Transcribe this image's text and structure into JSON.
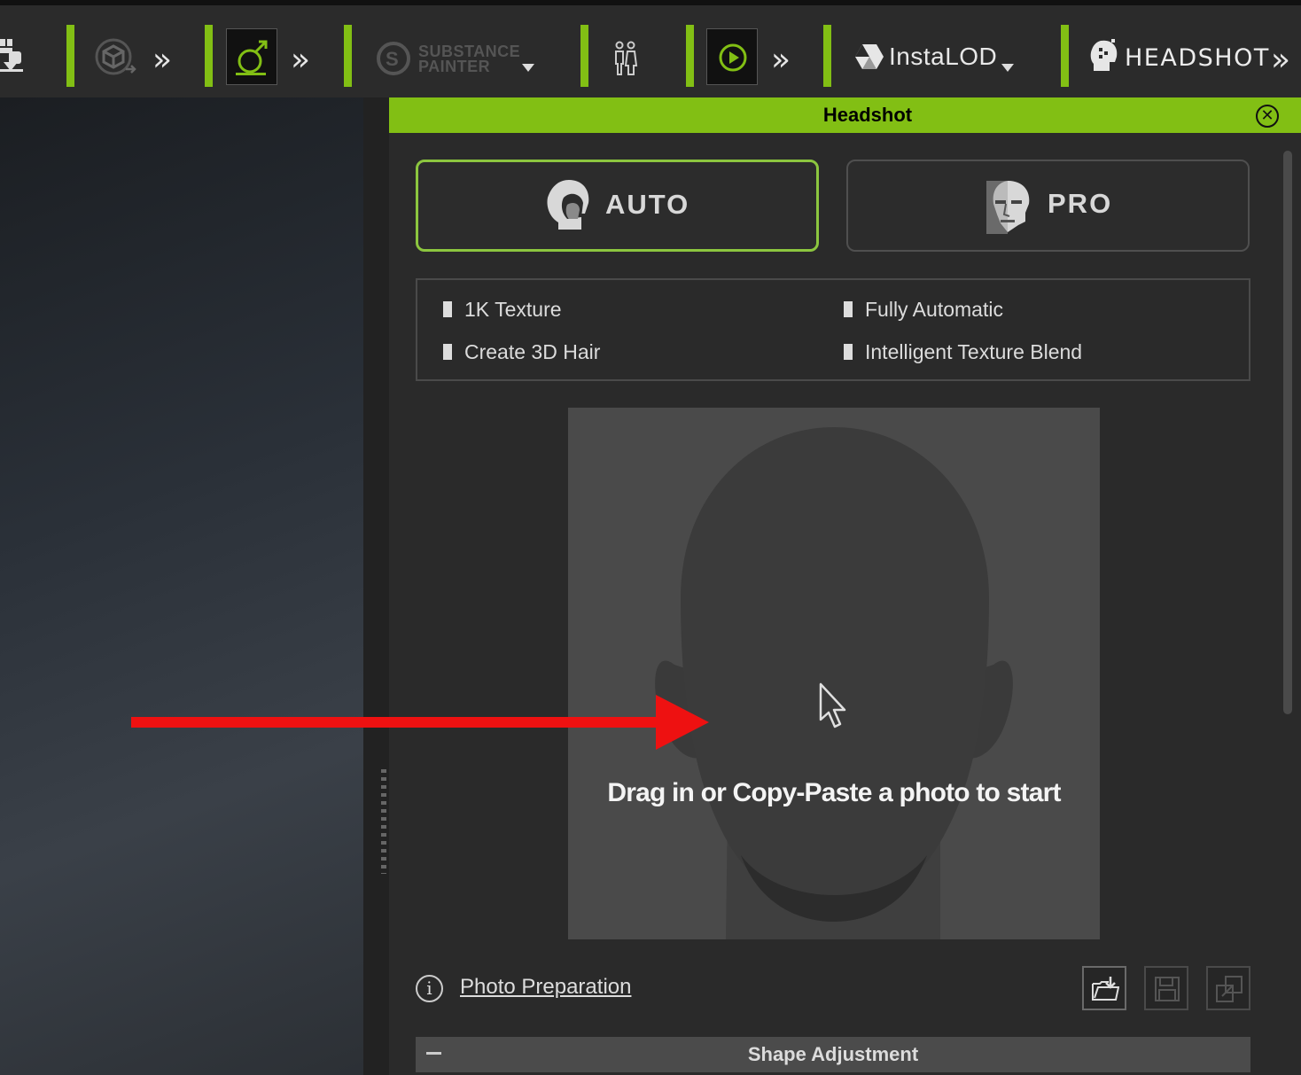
{
  "toolbar": {
    "substance": {
      "line1": "SUBSTANCE",
      "line2": "PAINTER"
    },
    "instalod": {
      "label": "InstaLOD"
    },
    "headshot": {
      "label": "HEADSHOT"
    },
    "chevron": "»",
    "accent_color": "#82bf14"
  },
  "panel": {
    "title": "Headshot",
    "close_symbol": "✕",
    "modes": [
      {
        "label": "AUTO",
        "selected": true
      },
      {
        "label": "PRO",
        "selected": false
      }
    ],
    "features": [
      "1K Texture",
      "Fully Automatic",
      "Create 3D Hair",
      "Intelligent Texture Blend"
    ],
    "dropzone": {
      "text": "Drag in or Copy-Paste a photo to start"
    },
    "info_symbol": "i",
    "photo_link": "Photo Preparation",
    "section": {
      "title": "Shape Adjustment",
      "toggle": "minus"
    }
  },
  "icons": {
    "toolbar": [
      "character-transfer-icon",
      "cube-sync-icon",
      "morph-icon",
      "substance-painter-icon",
      "figures-icon",
      "play-icon",
      "instalod-icon",
      "headshot-icon"
    ],
    "bottom": [
      "import-folder-icon",
      "save-icon",
      "export-icon"
    ]
  },
  "annotation_color": "#ee1111"
}
